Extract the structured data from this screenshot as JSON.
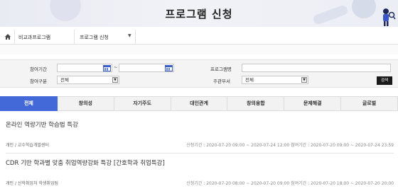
{
  "banner": {
    "title": "프로그램 신청"
  },
  "breadcrumb": {
    "home_icon": "home-icon",
    "item1": "비교과프로그램",
    "item2": "프로그램 신청"
  },
  "filter": {
    "period_label": "참여기간",
    "type_label": "참여구분",
    "type_value": "전체",
    "name_label": "프로그램명",
    "dept_label": "주관부서",
    "dept_value": "전체",
    "search_label": "검색"
  },
  "tabs": [
    "전체",
    "창의성",
    "자기주도",
    "대인관계",
    "창의융합",
    "문제해결",
    "글로벌"
  ],
  "programs": [
    {
      "title": "온라인 역량기반 학습법 특강",
      "meta": "개인 / 교수학습개발센터",
      "dates": "신청기간 : 2020-07-20 09:00 ~ 2020-07-24 12:00   참여기간 : 2020-07-20 09:00 ~ 2020-07-24 23:59"
    },
    {
      "title": "CDR 기반 학과별 맞춤 취업역량강화 특강 [간호학과 취업특강]",
      "meta": "개인 / 산학취업처 학생취업팀",
      "dates": "신청기간 : 2020-07-20 08:00 ~ 2020-07-20 09:00   참여기간 : 2020-07-20 18:00 ~ 2020-07-20 20:00"
    }
  ],
  "colors": {
    "tab_active": "#4368d8",
    "search_button": "#1a1a1a"
  }
}
